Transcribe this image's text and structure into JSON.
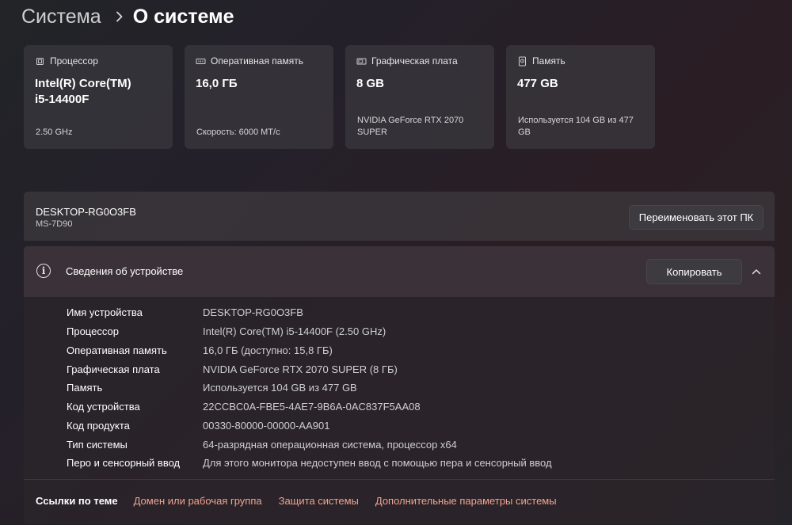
{
  "breadcrumb": {
    "parent": "Система",
    "current": "О системе"
  },
  "cards": [
    {
      "icon": "cpu-icon",
      "title": "Процессор",
      "value_line1": "Intel(R) Core(TM)",
      "value_line2": "i5-14400F",
      "sub_line1": "2.50 GHz",
      "sub_line2": ""
    },
    {
      "icon": "ram-icon",
      "title": "Оперативная память",
      "value_line1": "16,0 ГБ",
      "value_line2": "",
      "sub_line1": "Скорость: 6000 МТ/с",
      "sub_line2": ""
    },
    {
      "icon": "gpu-icon",
      "title": "Графическая плата",
      "value_line1": "8 GB",
      "value_line2": "",
      "sub_line1": "NVIDIA GeForce RTX 2070",
      "sub_line2": "SUPER"
    },
    {
      "icon": "storage-icon",
      "title": "Память",
      "value_line1": "477 GB",
      "value_line2": "",
      "sub_line1": "Используется 104 GB из 477",
      "sub_line2": "GB"
    }
  ],
  "device": {
    "name": "DESKTOP-RG0O3FB",
    "model": "MS-7D90",
    "rename_label": "Переименовать этот ПК"
  },
  "info": {
    "title": "Сведения об устройстве",
    "copy_label": "Копировать",
    "rows": [
      {
        "key": "Имя устройства",
        "value": "DESKTOP-RG0O3FB"
      },
      {
        "key": "Процессор",
        "value": "Intel(R) Core(TM) i5-14400F (2.50 GHz)"
      },
      {
        "key": "Оперативная память",
        "value": "16,0 ГБ (доступно: 15,8 ГБ)"
      },
      {
        "key": "Графическая плата",
        "value": "NVIDIA GeForce RTX 2070 SUPER (8 ГБ)"
      },
      {
        "key": "Память",
        "value": "Используется 104 GB из 477 GB"
      },
      {
        "key": "Код устройства",
        "value": "22CCBC0A-FBE5-4AE7-9B6A-0AC837F5AA08"
      },
      {
        "key": "Код продукта",
        "value": "00330-80000-00000-AA901"
      },
      {
        "key": "Тип системы",
        "value": "64-разрядная операционная система, процессор x64"
      },
      {
        "key": "Перо и сенсорный ввод",
        "value": "Для этого монитора недоступен ввод с помощью пера и сенсорный ввод"
      }
    ]
  },
  "related": {
    "label": "Ссылки по теме",
    "links": [
      "Домен или рабочая группа",
      "Защита системы",
      "Дополнительные параметры системы"
    ]
  },
  "colors": {
    "link": "#f0a491",
    "card_bg": "#3a383e",
    "button_bg": "#3d3a40"
  }
}
